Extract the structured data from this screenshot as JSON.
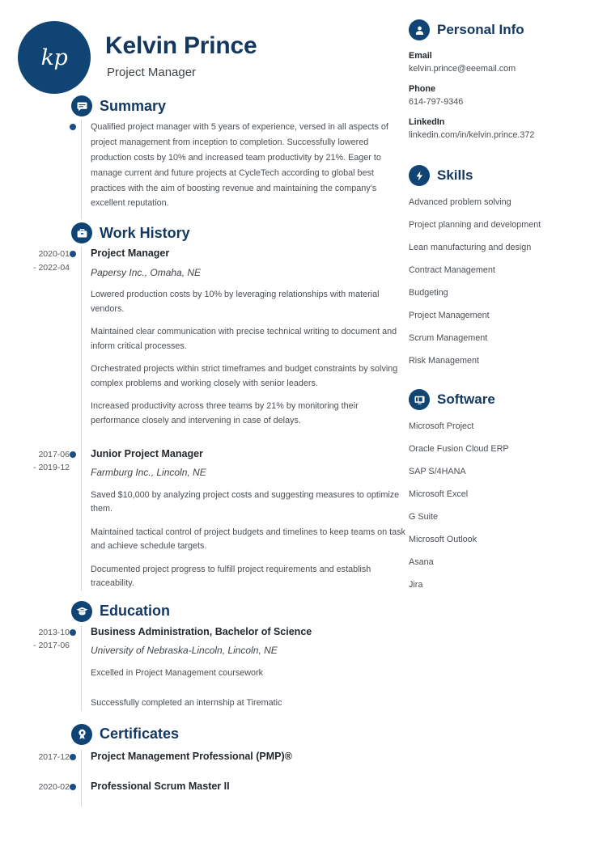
{
  "colors": {
    "navy": "#0f4474",
    "heading": "#13375f",
    "body": "#4a4f54",
    "dot": "#1a4d86",
    "line": "#d4d7da"
  },
  "header": {
    "initials": "kp",
    "name": "Kelvin Prince",
    "title": "Project Manager"
  },
  "summary": {
    "icon": "speech-bubble-icon",
    "heading": "Summary",
    "text": "Qualified project manager with 5 years of experience, versed in all aspects of project management from inception to completion. Successfully lowered production costs by 10% and increased team productivity by 21%. Eager to manage current and future projects at CycleTech according to global best practices with the aim of boosting revenue and maintaining the company's excellent reputation."
  },
  "work_history": {
    "icon": "briefcase-icon",
    "heading": "Work History",
    "entries": [
      {
        "date_start": "2020-01",
        "date_end": "- 2022-04",
        "role": "Project Manager",
        "organization": "Papersy Inc., Omaha, NE",
        "bullets": [
          "Lowered production costs by 10% by leveraging relationships with material vendors.",
          "Maintained clear communication with precise technical writing to document and inform critical processes.",
          "Orchestrated projects within strict timeframes and budget constraints by solving complex problems and working closely with senior leaders.",
          "Increased productivity across three teams by 21% by monitoring their performance closely and intervening in case of delays."
        ]
      },
      {
        "date_start": "2017-06",
        "date_end": "- 2019-12",
        "role": "Junior Project Manager",
        "organization": "Farmburg Inc., Lincoln, NE",
        "bullets": [
          "Saved $10,000 by analyzing project costs and suggesting measures to optimize them.",
          "Maintained tactical control of project budgets and timelines to keep teams on task and achieve schedule targets.",
          "Documented project progress to fulfill project requirements and establish traceability."
        ]
      }
    ]
  },
  "education": {
    "icon": "graduation-cap-icon",
    "heading": "Education",
    "entries": [
      {
        "date_start": "2013-10",
        "date_end": "- 2017-06",
        "role": "Business Administration, Bachelor of Science",
        "organization": "University of Nebraska-Lincoln, Lincoln, NE",
        "bullets": [
          "Excelled in Project Management coursework",
          "Successfully completed an internship at Tirematic"
        ]
      }
    ]
  },
  "certificates": {
    "icon": "award-icon",
    "heading": "Certificates",
    "entries": [
      {
        "date": "2017-12",
        "name": "Project Management Professional (PMP)®"
      },
      {
        "date": "2020-02",
        "name": "Professional Scrum Master II"
      }
    ]
  },
  "personal_info": {
    "icon": "person-icon",
    "heading": "Personal Info",
    "fields": [
      {
        "label": "Email",
        "value": "kelvin.prince@eeemail.com"
      },
      {
        "label": "Phone",
        "value": "614-797-9346"
      },
      {
        "label": "LinkedIn",
        "value": "linkedin.com/in/kelvin.prince.372"
      }
    ]
  },
  "skills": {
    "icon": "lightning-bolt-icon",
    "heading": "Skills",
    "items": [
      "Advanced problem solving",
      "Project planning and development",
      "Lean manufacturing and design",
      "Contract Management",
      "Budgeting",
      "Project Management",
      "Scrum Management",
      "Risk Management"
    ]
  },
  "software": {
    "icon": "monitor-icon",
    "heading": "Software",
    "items": [
      "Microsoft Project",
      "Oracle Fusion Cloud ERP",
      "SAP S/4HANA",
      "Microsoft Excel",
      "G Suite",
      "Microsoft Outlook",
      "Asana",
      "Jira"
    ]
  }
}
